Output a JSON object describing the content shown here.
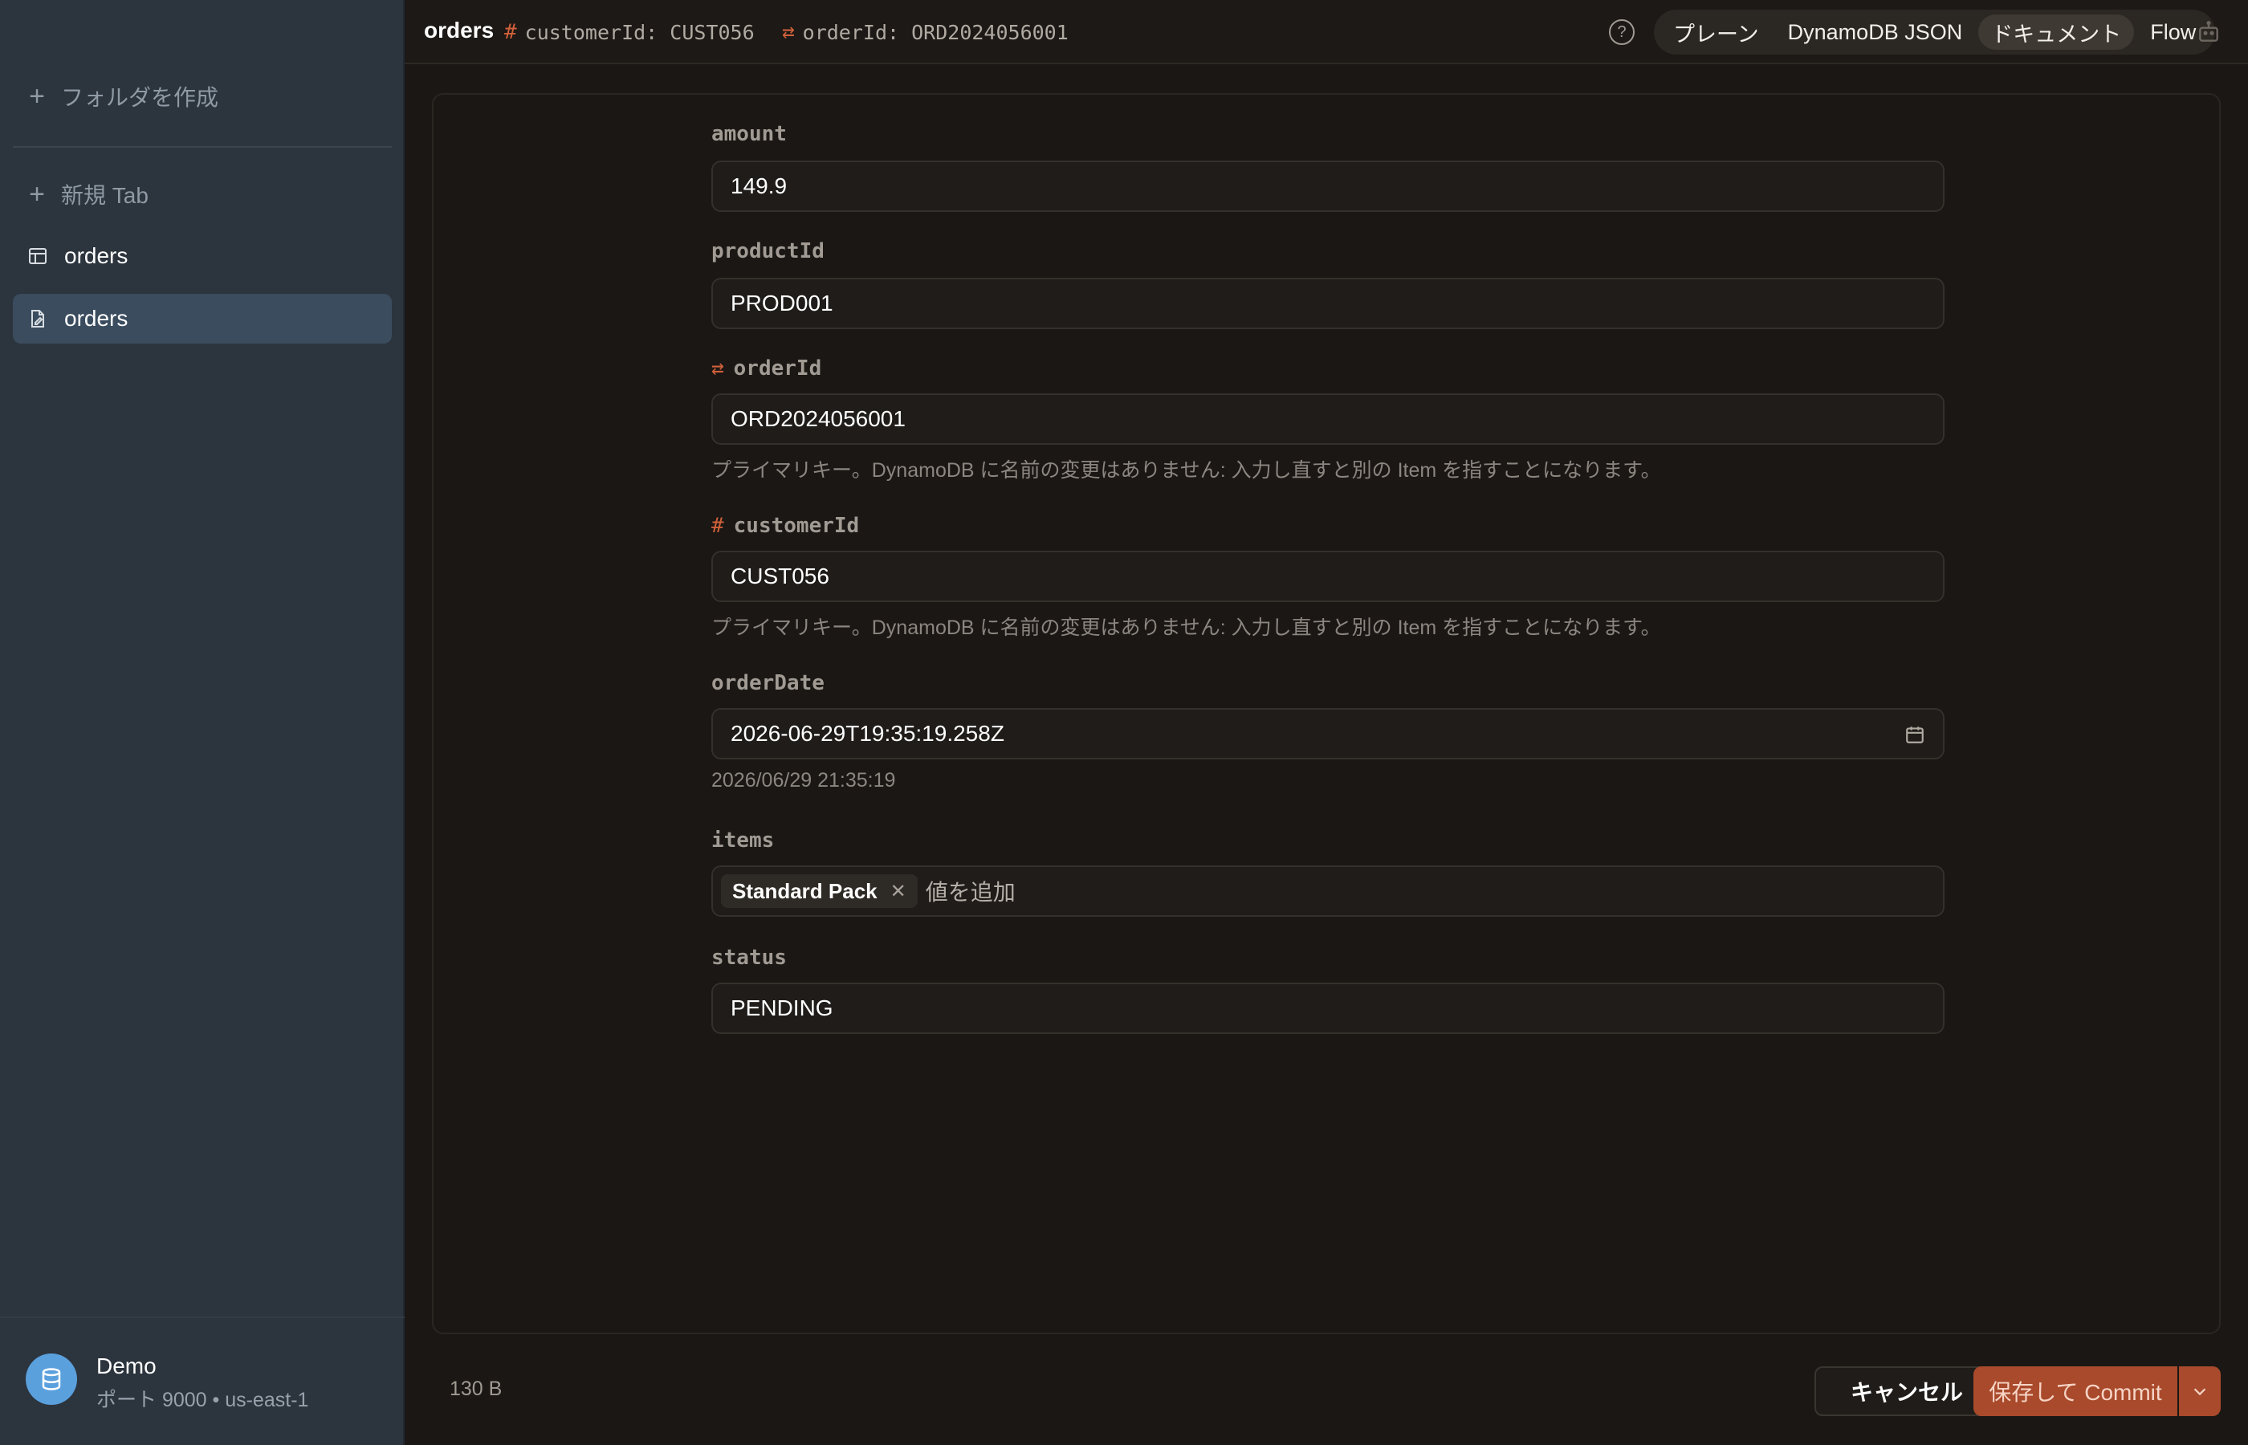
{
  "sidebar": {
    "create_folder": "フォルダを作成",
    "new_tab": "新規 Tab",
    "items": [
      {
        "label": "orders",
        "icon": "table-icon",
        "active": false
      },
      {
        "label": "orders",
        "icon": "document-icon",
        "active": true
      }
    ],
    "footer": {
      "name": "Demo",
      "sub": "ポート 9000 • us-east-1",
      "icon": "database-icon"
    }
  },
  "topbar": {
    "title": "orders",
    "keys": [
      {
        "glyph": "#",
        "text": "customerId: CUST056"
      },
      {
        "glyph": "⇄",
        "text": "orderId: ORD2024056001"
      }
    ],
    "modes": [
      {
        "label": "プレーン",
        "active": false
      },
      {
        "label": "DynamoDB JSON",
        "active": false
      },
      {
        "label": "ドキュメント",
        "active": true
      },
      {
        "label": "Flow",
        "active": false
      }
    ]
  },
  "fields": {
    "amount": {
      "label": "amount",
      "value": "149.9"
    },
    "productId": {
      "label": "productId",
      "value": "PROD001"
    },
    "orderId": {
      "label": "orderId",
      "glyph": "⇄",
      "value": "ORD2024056001",
      "hint": "プライマリキー。DynamoDB に名前の変更はありません: 入力し直すと別の Item を指すことになります。"
    },
    "customerId": {
      "label": "customerId",
      "glyph": "#",
      "value": "CUST056",
      "hint": "プライマリキー。DynamoDB に名前の変更はありません: 入力し直すと別の Item を指すことになります。"
    },
    "orderDate": {
      "label": "orderDate",
      "value": "2026-06-29T19:35:19.258Z",
      "hint": "2026/06/29 21:35:19"
    },
    "items": {
      "label": "items",
      "chips": [
        "Standard Pack"
      ],
      "add_placeholder": "値を追加"
    },
    "status": {
      "label": "status",
      "value": "PENDING"
    }
  },
  "footer": {
    "size": "130 B",
    "cancel": "キャンセル",
    "save": "保存して Commit"
  },
  "colors": {
    "accent": "#a84a2b",
    "key_glyph": "#d0603a",
    "sidebar_active": "#3a4c5e"
  }
}
